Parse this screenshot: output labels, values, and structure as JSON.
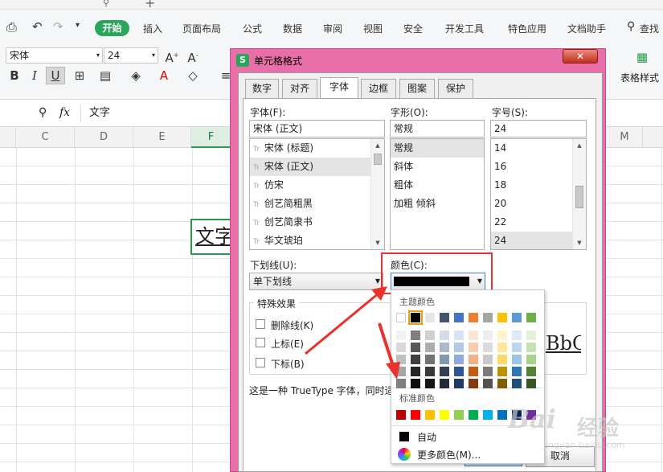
{
  "menubar": {
    "start_label": "开始",
    "items": [
      "插入",
      "页面布局",
      "公式",
      "数据",
      "审阅",
      "视图",
      "安全",
      "开发工具",
      "特色应用",
      "文档助手"
    ],
    "search_label": "查找"
  },
  "toolbar": {
    "font_name": "宋体",
    "font_size": "24",
    "table_style_label": "表格样式"
  },
  "formula": {
    "fx_label": "fx",
    "content": "文字"
  },
  "columns": [
    "C",
    "D",
    "E",
    "F",
    "M"
  ],
  "cell": {
    "text": "文字"
  },
  "dialog": {
    "title": "单元格格式",
    "tabs": [
      "数字",
      "对齐",
      "字体",
      "边框",
      "图案",
      "保护"
    ],
    "font": {
      "label": "字体(F):",
      "value": "宋体 (正文)",
      "items": [
        "宋体 (标题)",
        "宋体 (正文)",
        "仿宋",
        "创艺简粗黑",
        "创艺简隶书",
        "华文琥珀"
      ]
    },
    "style": {
      "label": "字形(O):",
      "value": "常规",
      "items": [
        "常规",
        "斜体",
        "粗体",
        "加粗 倾斜"
      ]
    },
    "size": {
      "label": "字号(S):",
      "value": "24",
      "items": [
        "14",
        "16",
        "18",
        "20",
        "22",
        "24"
      ]
    },
    "underline": {
      "label": "下划线(U):",
      "value": "单下划线"
    },
    "color": {
      "label": "颜色(C):",
      "value": "#000000"
    },
    "effects": {
      "label": "特殊效果",
      "items": [
        "删除线(K)",
        "上标(E)",
        "下标(B)"
      ]
    },
    "preview": "BbC",
    "description": "这是一种 TrueType 字体，同时适",
    "cancel_label": "取消"
  },
  "palette": {
    "theme_label": "主题颜色",
    "theme_top": [
      "#ffffff",
      "#000000",
      "#e7e6e6",
      "#44546a",
      "#4472c4",
      "#ed7d31",
      "#a5a5a5",
      "#ffc000",
      "#5b9bd5",
      "#70ad47"
    ],
    "theme_rows": [
      [
        "#f2f2f2",
        "#7f7f7f",
        "#d0cece",
        "#d6dce5",
        "#dae3f3",
        "#fbe5d6",
        "#ededed",
        "#fff2cc",
        "#deebf7",
        "#e2f0d9"
      ],
      [
        "#d9d9d9",
        "#595959",
        "#aeabab",
        "#adb9ca",
        "#b4c7e7",
        "#f8cbad",
        "#dbdbdb",
        "#ffe699",
        "#bdd7ee",
        "#c5e0b4"
      ],
      [
        "#bfbfbf",
        "#404040",
        "#757171",
        "#8497b0",
        "#8faadc",
        "#f4b183",
        "#c9c9c9",
        "#ffd966",
        "#9dc3e6",
        "#a9d18e"
      ],
      [
        "#a6a6a6",
        "#262626",
        "#3a3838",
        "#333f50",
        "#2f5597",
        "#c55a11",
        "#7b7b7b",
        "#bf9000",
        "#2e75b6",
        "#548235"
      ],
      [
        "#808080",
        "#0d0d0d",
        "#171616",
        "#222a35",
        "#203864",
        "#843c0c",
        "#525252",
        "#7f6000",
        "#1f4e79",
        "#385723"
      ]
    ],
    "standard_label": "标准颜色",
    "standard": [
      "#c00000",
      "#ff0000",
      "#ffc000",
      "#ffff00",
      "#92d050",
      "#00b050",
      "#00b0f0",
      "#0070c0",
      "#002060",
      "#7030a0"
    ],
    "auto_label": "自动",
    "more_label": "更多颜色(M)..."
  },
  "watermark": {
    "brand": "Bai",
    "suffix": "经验",
    "url": "jingyan.baidu.com"
  }
}
